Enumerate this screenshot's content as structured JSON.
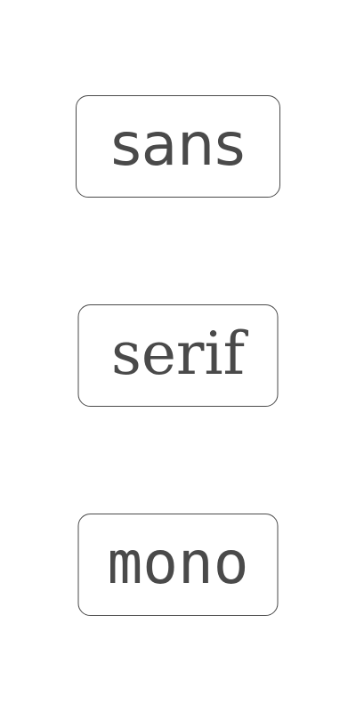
{
  "options": {
    "sans": {
      "label": "sans"
    },
    "serif": {
      "label": "serif"
    },
    "mono": {
      "label": "mono"
    }
  },
  "colors": {
    "text": "#4a4a4a",
    "border": "#4a4a4a",
    "background": "#ffffff"
  }
}
